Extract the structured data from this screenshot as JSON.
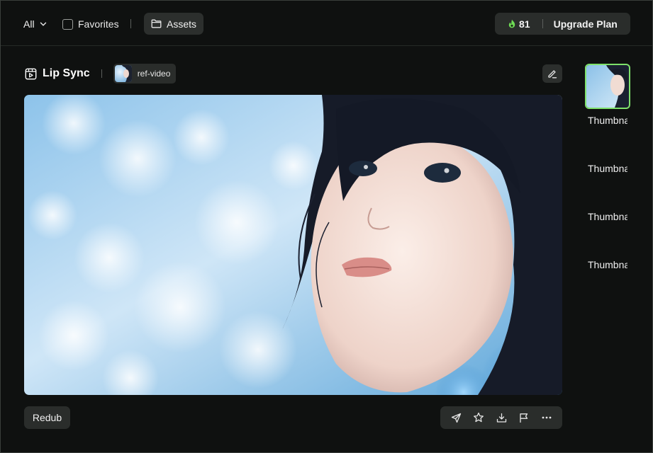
{
  "topbar": {
    "filter_label": "All",
    "favorites_label": "Favorites",
    "assets_label": "Assets",
    "credits": "81",
    "upgrade_label": "Upgrade Plan"
  },
  "header": {
    "title": "Lip Sync",
    "ref_label": "ref-video"
  },
  "actions": {
    "redub_label": "Redub",
    "more_label": "···"
  },
  "thumbnails": [
    {
      "label": "Thumbnail"
    },
    {
      "label": "Thumbnail"
    },
    {
      "label": "Thumbnail"
    },
    {
      "label": "Thumbnail"
    }
  ],
  "colors": {
    "accent": "#7ee16a",
    "credit_icon": "#6fdc55"
  },
  "icons": [
    "chevron-down-icon",
    "folder-icon",
    "flame-icon",
    "film-icon",
    "edit-icon",
    "send-icon",
    "star-icon",
    "download-icon",
    "flag-icon",
    "more-icon"
  ]
}
